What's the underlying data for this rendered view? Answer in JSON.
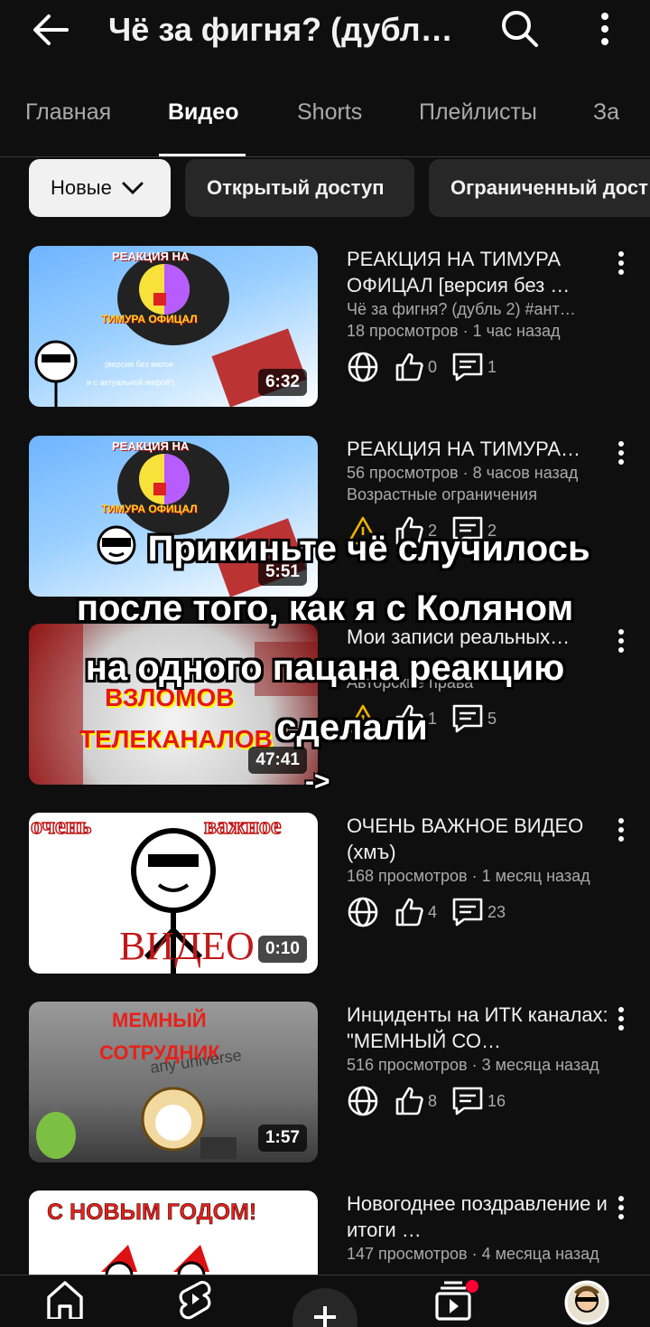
{
  "header": {
    "title": "Чё за фигня? (дубл…",
    "back_icon": "arrow-left-icon",
    "search_icon": "search-icon",
    "more_icon": "more-vert-icon"
  },
  "tabs": [
    {
      "label": "Главная"
    },
    {
      "label": "Видео",
      "active": true
    },
    {
      "label": "Shorts"
    },
    {
      "label": "Плейлисты"
    },
    {
      "label": "За"
    }
  ],
  "chips": [
    {
      "label": "Новые",
      "selected": true
    },
    {
      "label": "Открытый доступ"
    },
    {
      "label": "Ограниченный дост"
    }
  ],
  "videos": [
    {
      "title": "РЕАКЦИЯ НА ТИМУРА ОФИЦАЛ [версия без …",
      "subtitle": "Чё за фигня? (дубль 2) #ант…",
      "views": "18 просмотров · 1 час назад",
      "duration": "6:32",
      "likes": "0",
      "comments": "1",
      "thumb_lines": [
        "РЕАКЦИЯ НА",
        "ТИМУРА ОФИЦАЛ",
        "(версия без матов",
        "и с актуальной инфой!)"
      ]
    },
    {
      "title": "РЕАКЦИЯ НА ТИМУРА…",
      "views": "56 просмотров · 8 часов назад",
      "restriction": "Возрастные ограничения",
      "duration": "5:51",
      "likes": "2",
      "comments": "2",
      "thumb_lines": [
        "РЕАКЦИЯ НА",
        "ТИМУРА ОФИЦАЛ"
      ]
    },
    {
      "title": "Мои записи реальных…",
      "restriction": "Авторские права",
      "duration": "47:41",
      "likes": "1",
      "comments": "5",
      "thumb_lines": [
        "ВЗЛОМОВ",
        "ТЕЛЕКАНАЛОВ"
      ]
    },
    {
      "title": "ОЧЕНЬ ВАЖНОЕ ВИДЕО (хмъ)",
      "views": "168 просмотров · 1 месяц назад",
      "duration": "0:10",
      "likes": "4",
      "comments": "23",
      "thumb_lines": [
        "очень",
        "важное",
        "ВИДЕО"
      ]
    },
    {
      "title": "Инциденты на ИТК каналах: \"МЕМНЫЙ СО…",
      "views": "516 просмотров · 3 месяца назад",
      "duration": "1:57",
      "likes": "8",
      "comments": "16",
      "thumb_lines": [
        "МЕМНЫЙ",
        "СОТРУДНИК",
        "any universe"
      ]
    },
    {
      "title": "Новогоднее поздравление и итоги …",
      "views": "147 просмотров · 4 месяца назад",
      "thumb_lines": [
        "С НОВЫМ ГОДОМ!"
      ]
    }
  ],
  "overlay": {
    "lines": [
      "Прикиньте чё случилось",
      "после того, как я с Коляном",
      "на одного пацана реакцию",
      "сделали"
    ],
    "arrow": "->"
  },
  "bottom_nav": [
    "home-icon",
    "shorts-icon",
    "create-plus-icon",
    "subscriptions-icon",
    "avatar"
  ],
  "colors": {
    "background": "#0f0f0f",
    "text": "#f1f1f1",
    "secondary_text": "#aaaaaa",
    "chip": "#272727",
    "notification_dot": "#ff0033"
  }
}
